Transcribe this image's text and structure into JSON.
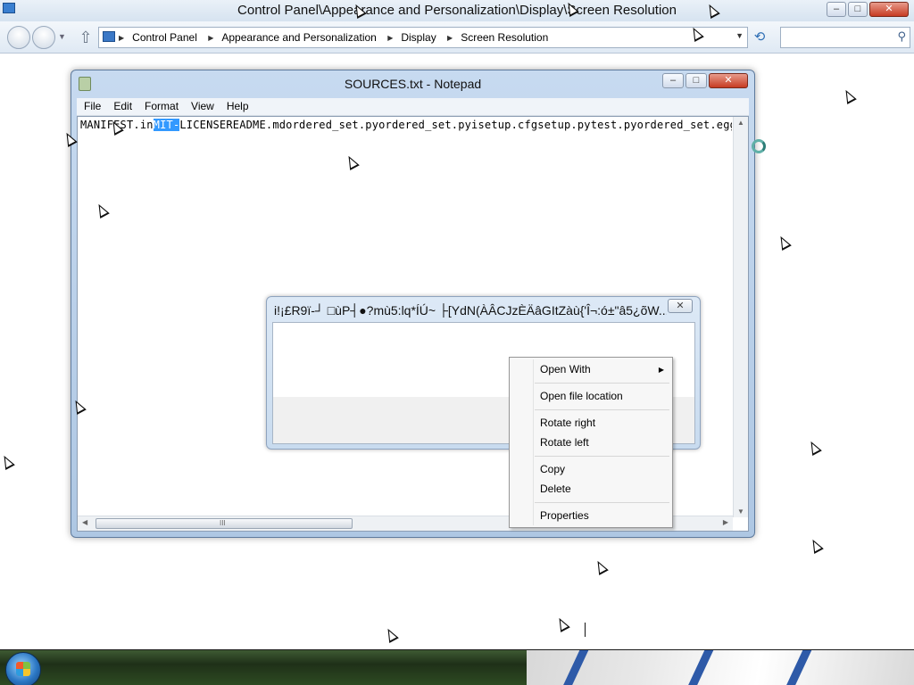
{
  "explorer": {
    "title": "Control Panel\\Appearance and Personalization\\Display\\Screen Resolution",
    "breadcrumbs": [
      "Control Panel",
      "Appearance and Personalization",
      "Display",
      "Screen Resolution"
    ],
    "search_placeholder": "",
    "icons": {
      "back": "back-arrow-icon",
      "forward": "forward-arrow-icon",
      "up": "up-arrow-icon",
      "refresh": "refresh-icon",
      "search": "magnifier-icon"
    }
  },
  "notepad": {
    "title": "SOURCES.txt - Notepad",
    "menu": [
      "File",
      "Edit",
      "Format",
      "View",
      "Help"
    ],
    "text_before": "MANIFEST.in",
    "text_selected": "MIT-",
    "text_after": "LICENSEREADME.mdordered_set.pyordered_set.pyisetup.cfgsetup.pytest.pyordered_set.egg-info/PKG-INFO",
    "hscroll_grip": "III"
  },
  "dialog": {
    "title": "i!¡£R9ï-┘ □ùP┤●?mù5:lq*ÍÚ~ ├[YdN(ÀÂCJzÈÄâGItZàù{'Î¬:ó±\"â5¿õW...",
    "close_glyph": "✕"
  },
  "context_menu": {
    "items": [
      "Open With",
      "Open file location",
      "Rotate right",
      "Rotate left",
      "Copy",
      "Delete",
      "Properties"
    ],
    "submenu_glyph": "▶"
  },
  "window_controls": {
    "minimize": "–",
    "maximize": "□",
    "close": "✕"
  }
}
